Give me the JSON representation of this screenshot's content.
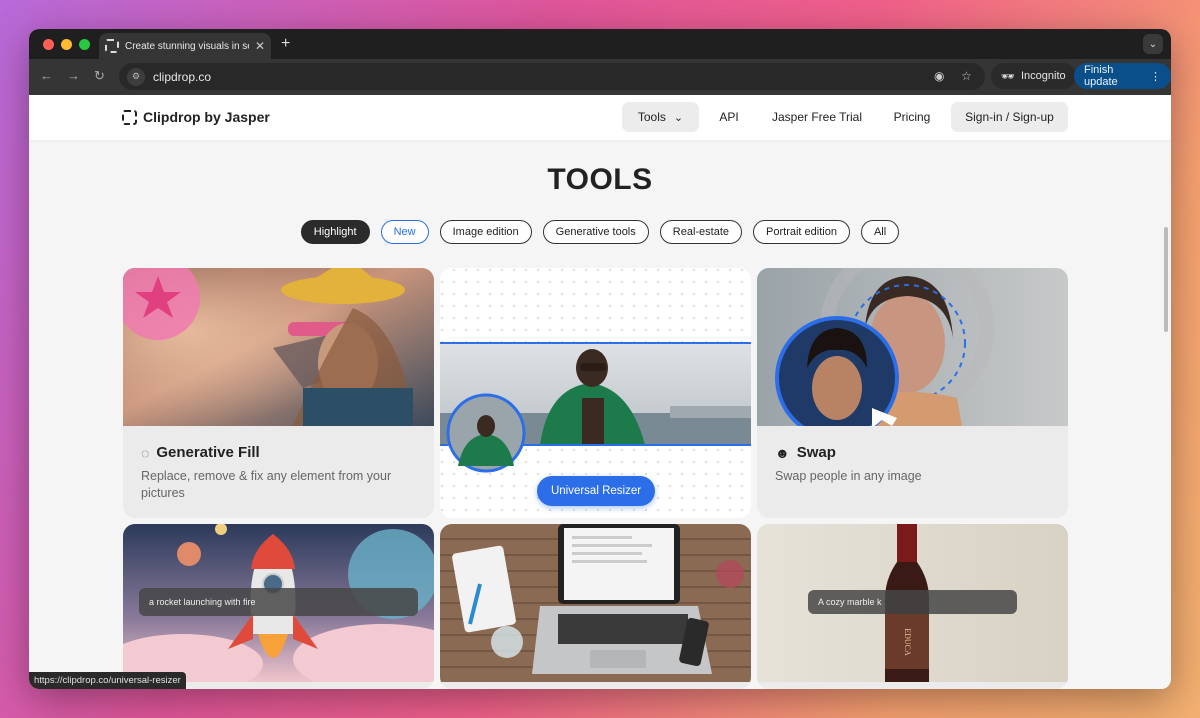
{
  "browser": {
    "tab_title": "Create stunning visuals in seconds",
    "new_tab": "+",
    "address": "clipdrop.co",
    "incognito_label": "Incognito",
    "finish_update_label": "Finish update",
    "status_url": "https://clipdrop.co/universal-resizer",
    "traffic_colors": [
      "#ff5f57",
      "#febc2e",
      "#28c840"
    ]
  },
  "site": {
    "logo_text": "Clipdrop by Jasper",
    "nav": {
      "tools": "Tools",
      "api": "API",
      "trial": "Jasper Free Trial",
      "pricing": "Pricing",
      "signin": "Sign-in / Sign-up"
    }
  },
  "main": {
    "heading": "TOOLS",
    "filters": [
      "Highlight",
      "New",
      "Image edition",
      "Generative tools",
      "Real-estate",
      "Portrait edition",
      "All"
    ],
    "cards": {
      "generative_fill": {
        "title": "Generative Fill",
        "description": "Replace, remove & fix any element from your pictures"
      },
      "universal_resizer": {
        "button": "Universal Resizer"
      },
      "swap": {
        "title": "Swap",
        "description": "Swap people in any image"
      },
      "rocket": {
        "prompt": "a rocket launching with fire"
      },
      "bottle": {
        "prompt": "A cozy marble k"
      }
    }
  },
  "colors": {
    "accent": "#2b6ee8",
    "finish_update": "#0b4f8a"
  }
}
